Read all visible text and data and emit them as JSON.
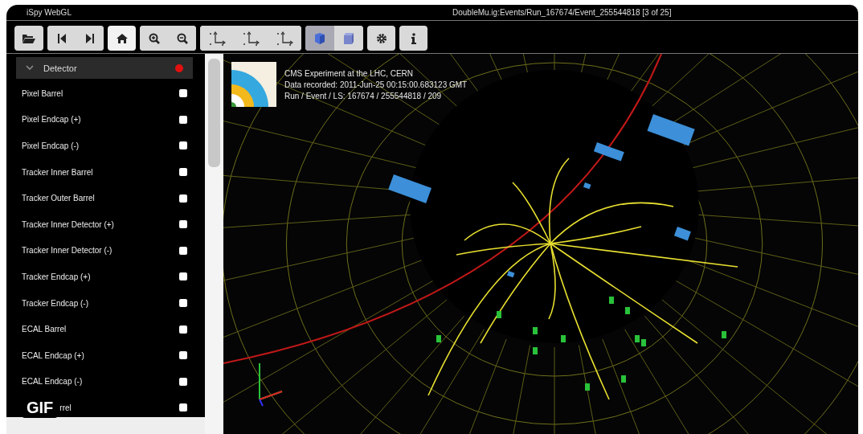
{
  "app": {
    "name": "iSpy WebGL",
    "title": "DoubleMu.ig:Events/Run_167674/Event_255544818 [3 of 25]"
  },
  "toolbar": [
    {
      "buttons": [
        {
          "kind": "open"
        }
      ]
    },
    {
      "buttons": [
        {
          "kind": "first"
        },
        {
          "kind": "last"
        }
      ]
    },
    {
      "buttons": [
        {
          "kind": "home"
        }
      ]
    },
    {
      "buttons": [
        {
          "kind": "zoom-in"
        },
        {
          "kind": "zoom-out"
        }
      ]
    },
    {
      "buttons": [
        {
          "kind": "view-yx"
        },
        {
          "kind": "view-rz"
        },
        {
          "kind": "view-xz"
        }
      ]
    },
    {
      "buttons": [
        {
          "kind": "perspective",
          "selected": true
        },
        {
          "kind": "orthographic",
          "selected": false
        }
      ]
    },
    {
      "buttons": [
        {
          "kind": "settings"
        }
      ]
    },
    {
      "buttons": [
        {
          "kind": "info"
        }
      ]
    }
  ],
  "sidebar": {
    "section": {
      "label": "Detector",
      "expanded": true
    },
    "items": [
      {
        "label": "Pixel Barrel",
        "checked": false
      },
      {
        "label": "Pixel Endcap (+)",
        "checked": false
      },
      {
        "label": "Pixel Endcap (-)",
        "checked": false
      },
      {
        "label": "Tracker Inner Barrel",
        "checked": false
      },
      {
        "label": "Tracker Outer Barrel",
        "checked": false
      },
      {
        "label": "Tracker Inner Detector (+)",
        "checked": false
      },
      {
        "label": "Tracker Inner Detector (-)",
        "checked": false
      },
      {
        "label": "Tracker Endcap (+)",
        "checked": false
      },
      {
        "label": "Tracker Endcap (-)",
        "checked": false
      },
      {
        "label": "ECAL Barrel",
        "checked": false
      },
      {
        "label": "ECAL Endcap (+)",
        "checked": false
      },
      {
        "label": "ECAL Endcap (-)",
        "checked": false
      },
      {
        "label": "rrel",
        "checked": false
      }
    ]
  },
  "event_info": {
    "lines": [
      "CMS Experiment at the LHC, CERN",
      "Data recorded: 2011-Jun-25 00:15:00.683123 GMT",
      "Run / Event / LS: 167674 / 255544818 / 209"
    ]
  },
  "media_badge": {
    "label": "GIF"
  }
}
